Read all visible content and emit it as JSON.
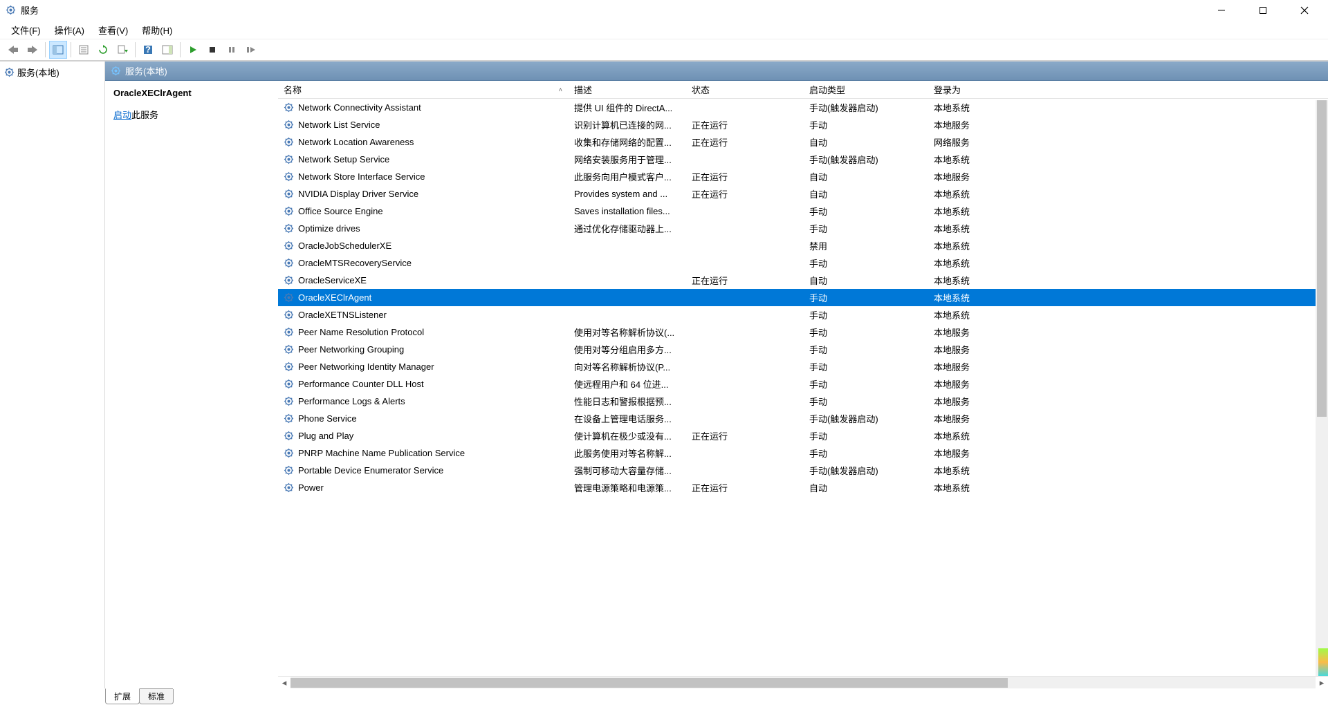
{
  "window": {
    "title": "服务"
  },
  "menu": {
    "file": "文件(F)",
    "action": "操作(A)",
    "view": "查看(V)",
    "help": "帮助(H)"
  },
  "tree": {
    "root": "服务(本地)"
  },
  "paneHeader": "服务(本地)",
  "selected": {
    "name": "OracleXEClrAgent",
    "action_link": "启动",
    "action_rest": "此服务"
  },
  "columns": {
    "name": "名称",
    "desc": "描述",
    "status": "状态",
    "startup": "启动类型",
    "logon": "登录为"
  },
  "rows": [
    {
      "name": "Network Connectivity Assistant",
      "desc": "提供 UI 组件的 DirectA...",
      "status": "",
      "startup": "手动(触发器启动)",
      "logon": "本地系统"
    },
    {
      "name": "Network List Service",
      "desc": "识别计算机已连接的网...",
      "status": "正在运行",
      "startup": "手动",
      "logon": "本地服务"
    },
    {
      "name": "Network Location Awareness",
      "desc": "收集和存储网络的配置...",
      "status": "正在运行",
      "startup": "自动",
      "logon": "网络服务"
    },
    {
      "name": "Network Setup Service",
      "desc": "网络安装服务用于管理...",
      "status": "",
      "startup": "手动(触发器启动)",
      "logon": "本地系统"
    },
    {
      "name": "Network Store Interface Service",
      "desc": "此服务向用户模式客户...",
      "status": "正在运行",
      "startup": "自动",
      "logon": "本地服务"
    },
    {
      "name": "NVIDIA Display Driver Service",
      "desc": "Provides system and ...",
      "status": "正在运行",
      "startup": "自动",
      "logon": "本地系统"
    },
    {
      "name": "Office  Source Engine",
      "desc": "Saves installation files...",
      "status": "",
      "startup": "手动",
      "logon": "本地系统"
    },
    {
      "name": "Optimize drives",
      "desc": "通过优化存储驱动器上...",
      "status": "",
      "startup": "手动",
      "logon": "本地系统"
    },
    {
      "name": "OracleJobSchedulerXE",
      "desc": "",
      "status": "",
      "startup": "禁用",
      "logon": "本地系统"
    },
    {
      "name": "OracleMTSRecoveryService",
      "desc": "",
      "status": "",
      "startup": "手动",
      "logon": "本地系统"
    },
    {
      "name": "OracleServiceXE",
      "desc": "",
      "status": "正在运行",
      "startup": "自动",
      "logon": "本地系统"
    },
    {
      "name": "OracleXEClrAgent",
      "desc": "",
      "status": "",
      "startup": "手动",
      "logon": "本地系统",
      "selected": true
    },
    {
      "name": "OracleXETNSListener",
      "desc": "",
      "status": "",
      "startup": "手动",
      "logon": "本地系统"
    },
    {
      "name": "Peer Name Resolution Protocol",
      "desc": "使用对等名称解析协议(...",
      "status": "",
      "startup": "手动",
      "logon": "本地服务"
    },
    {
      "name": "Peer Networking Grouping",
      "desc": "使用对等分组启用多方...",
      "status": "",
      "startup": "手动",
      "logon": "本地服务"
    },
    {
      "name": "Peer Networking Identity Manager",
      "desc": "向对等名称解析协议(P...",
      "status": "",
      "startup": "手动",
      "logon": "本地服务"
    },
    {
      "name": "Performance Counter DLL Host",
      "desc": "使远程用户和 64 位进...",
      "status": "",
      "startup": "手动",
      "logon": "本地服务"
    },
    {
      "name": "Performance Logs & Alerts",
      "desc": "性能日志和警报根据预...",
      "status": "",
      "startup": "手动",
      "logon": "本地服务"
    },
    {
      "name": "Phone Service",
      "desc": "在设备上管理电话服务...",
      "status": "",
      "startup": "手动(触发器启动)",
      "logon": "本地服务"
    },
    {
      "name": "Plug and Play",
      "desc": "使计算机在极少或没有...",
      "status": "正在运行",
      "startup": "手动",
      "logon": "本地系统"
    },
    {
      "name": "PNRP Machine Name Publication Service",
      "desc": "此服务使用对等名称解...",
      "status": "",
      "startup": "手动",
      "logon": "本地服务"
    },
    {
      "name": "Portable Device Enumerator Service",
      "desc": "强制可移动大容量存储...",
      "status": "",
      "startup": "手动(触发器启动)",
      "logon": "本地系统"
    },
    {
      "name": "Power",
      "desc": "管理电源策略和电源策...",
      "status": "正在运行",
      "startup": "自动",
      "logon": "本地系统"
    }
  ],
  "tabs": {
    "extended": "扩展",
    "standard": "标准"
  }
}
